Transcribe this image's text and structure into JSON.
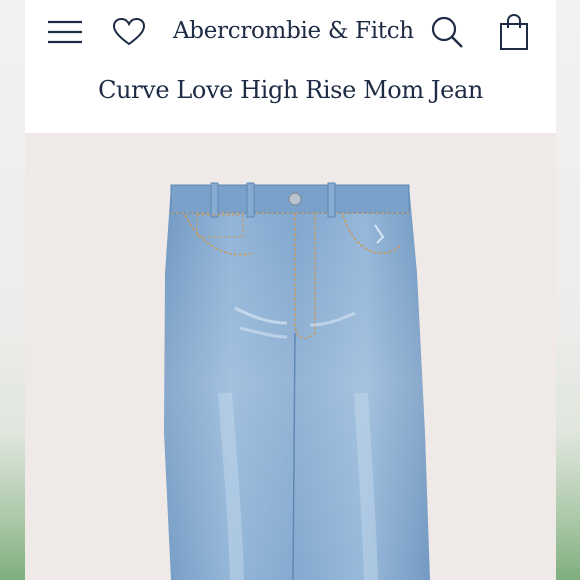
{
  "header": {
    "brand": "Abercrombie & Fitch",
    "icons": {
      "menu": "hamburger-menu-icon",
      "wishlist": "heart-icon",
      "search": "search-icon",
      "bag": "shopping-bag-icon"
    }
  },
  "product": {
    "title": "Curve Love High Rise Mom Jean"
  },
  "colors": {
    "brand_navy": "#1d2b44",
    "image_background": "#efeae7",
    "denim": "#86acd2"
  }
}
